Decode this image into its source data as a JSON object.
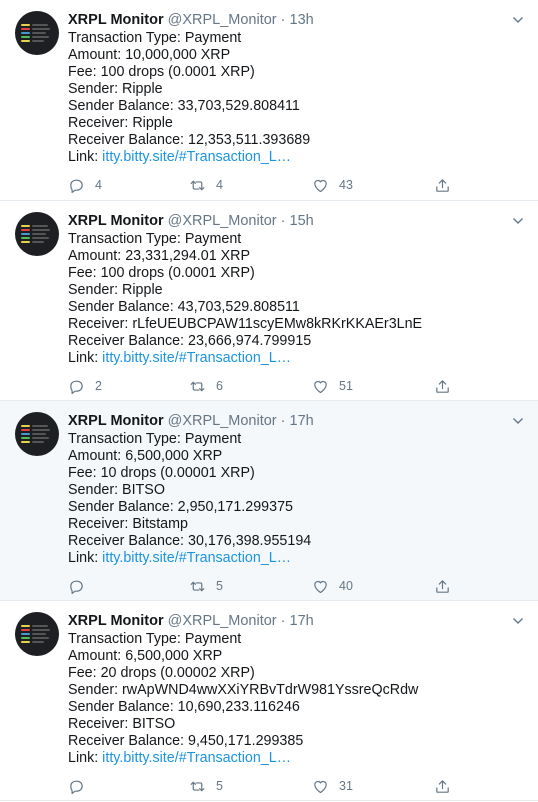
{
  "tweets": [
    {
      "name": "XRPL Monitor",
      "handle": "@XRPL_Monitor",
      "separator": "·",
      "time": "13h",
      "lines": [
        "Transaction Type: Payment",
        "Amount: 10,000,000 XRP",
        "Fee: 100 drops (0.0001 XRP)",
        "Sender: Ripple",
        "Sender Balance: 33,703,529.808411",
        "Receiver: Ripple",
        "Receiver Balance: 12,353,511.393689"
      ],
      "link_prefix": "Link: ",
      "link_text": "itty.bitty.site/#Transaction_L…",
      "replies": "4",
      "retweets": "4",
      "likes": "43"
    },
    {
      "name": "XRPL Monitor",
      "handle": "@XRPL_Monitor",
      "separator": "·",
      "time": "15h",
      "lines": [
        "Transaction Type: Payment",
        "Amount: 23,331,294.01 XRP",
        "Fee: 100 drops (0.0001 XRP)",
        "Sender: Ripple",
        "Sender Balance: 43,703,529.808511",
        "Receiver: rLfeUEUBCPAW11scyEMw8kRKrKKAEr3LnE",
        "Receiver Balance: 23,666,974.799915"
      ],
      "link_prefix": "Link: ",
      "link_text": "itty.bitty.site/#Transaction_L…",
      "replies": "2",
      "retweets": "6",
      "likes": "51"
    },
    {
      "name": "XRPL Monitor",
      "handle": "@XRPL_Monitor",
      "separator": "·",
      "time": "17h",
      "lines": [
        "Transaction Type: Payment",
        "Amount: 6,500,000 XRP",
        "Fee: 10 drops (0.00001 XRP)",
        "Sender: BITSO",
        "Sender Balance: 2,950,171.299375",
        "Receiver: Bitstamp",
        "Receiver Balance: 30,176,398.955194"
      ],
      "link_prefix": "Link: ",
      "link_text": "itty.bitty.site/#Transaction_L…",
      "replies": "",
      "retweets": "5",
      "likes": "40"
    },
    {
      "name": "XRPL Monitor",
      "handle": "@XRPL_Monitor",
      "separator": "·",
      "time": "17h",
      "lines": [
        "Transaction Type: Payment",
        "Amount: 6,500,000 XRP",
        "Fee: 20 drops (0.00002 XRP)",
        "Sender: rwApWND4wwXXiYRBvTdrW981YssreQcRdw",
        "Sender Balance: 10,690,233.116246",
        "Receiver: BITSO",
        "Receiver Balance: 9,450,171.299385"
      ],
      "link_prefix": "Link: ",
      "link_text": "itty.bitty.site/#Transaction_L…",
      "replies": "",
      "retweets": "5",
      "likes": "31"
    }
  ],
  "colors": {
    "name": "#14171a",
    "secondary": "#657786",
    "link": "#1b95e0",
    "divider": "#e6ecf0",
    "hover_background": "#f5f8fa"
  },
  "icons": {
    "reply": "reply-icon",
    "retweet": "retweet-icon",
    "like": "heart-icon",
    "share": "share-icon",
    "menu": "chevron-down-icon"
  }
}
